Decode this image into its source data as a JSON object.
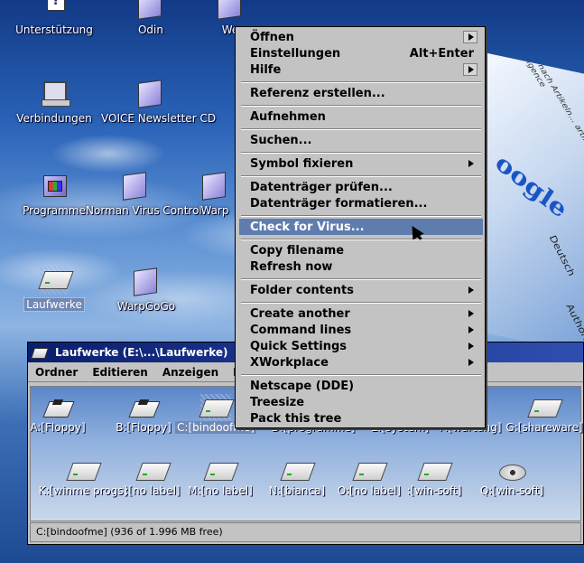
{
  "desktop": {
    "icons": [
      {
        "label": "Unterstützung",
        "icon": "help-book-icon"
      },
      {
        "label": "Odin",
        "icon": "folder-icon"
      },
      {
        "label": "We",
        "icon": "folder-icon"
      },
      {
        "label": "Verbindungen",
        "icon": "network-computer-icon"
      },
      {
        "label": "VOICE Newsletter CD",
        "icon": "folder-icon"
      },
      {
        "label": "Programme",
        "icon": "programs-folder-icon"
      },
      {
        "label": "Norman Virus Control",
        "icon": "folder-icon"
      },
      {
        "label": "Warp",
        "icon": "folder-icon"
      },
      {
        "label": "Laufwerke",
        "icon": "drives-icon"
      },
      {
        "label": "WarpGoGo",
        "icon": "folder-icon"
      }
    ],
    "banner_logo_text": "oogle",
    "banner_side_text": "Deutsch",
    "banner_top_text": "Suche nach Artikeln... artificial intelligence",
    "banner_author_text": "Author:"
  },
  "window": {
    "title": "Laufwerke (E:\\...\\Laufwerke)",
    "menu": [
      "Ordner",
      "Editieren",
      "Anzeigen",
      "H"
    ],
    "drives": [
      {
        "label": "A:[Floppy]",
        "icon": "floppy-drive-icon"
      },
      {
        "label": "B:[Floppy]",
        "icon": "floppy-drive-icon"
      },
      {
        "label": "C:[bindoofme]",
        "icon": "hard-drive-icon"
      },
      {
        "label": "D:[programme]",
        "icon": "hard-drive-icon"
      },
      {
        "label": "E:[system]",
        "icon": "hard-drive-icon"
      },
      {
        "label": "F:[wartung]",
        "icon": "hard-drive-icon"
      },
      {
        "label": "G:[shareware]",
        "icon": "hard-drive-icon"
      },
      {
        "label": "K:[winme progs]",
        "icon": "hard-drive-icon"
      },
      {
        "label": ":[no label]",
        "icon": "hard-drive-icon"
      },
      {
        "label": "M:[no label]",
        "icon": "hard-drive-icon"
      },
      {
        "label": "N:[bianca]",
        "icon": "hard-drive-icon"
      },
      {
        "label": "O:[no label]",
        "icon": "hard-drive-icon"
      },
      {
        "label": ":[win-soft]",
        "icon": "hard-drive-icon"
      },
      {
        "label": "Q:[win-soft]",
        "icon": "cd-rom-icon"
      }
    ],
    "status": "C:[bindoofme] (936 of 1.996 MB free)"
  },
  "context_menu": {
    "items": [
      {
        "label": "Öffnen",
        "submenu": true
      },
      {
        "label": "Einstellungen",
        "accel": "Alt+Enter"
      },
      {
        "label": "Hilfe",
        "submenu": true
      },
      {
        "label": "Referenz erstellen..."
      },
      {
        "label": "Aufnehmen"
      },
      {
        "label": "Suchen..."
      },
      {
        "label": "Symbol fixieren",
        "submenu": true
      },
      {
        "label": "Datenträger prüfen..."
      },
      {
        "label": "Datenträger formatieren..."
      },
      {
        "label": "Check for Virus...",
        "highlighted": true
      },
      {
        "label": "Copy filename"
      },
      {
        "label": "Refresh now"
      },
      {
        "label": "Folder contents",
        "submenu": true
      },
      {
        "label": "Create another",
        "submenu": true
      },
      {
        "label": "Command lines",
        "submenu": true
      },
      {
        "label": "Quick Settings",
        "submenu": true
      },
      {
        "label": "XWorkplace",
        "submenu": true
      },
      {
        "label": "Netscape (DDE)"
      },
      {
        "label": "Treesize"
      },
      {
        "label": "Pack this tree"
      }
    ]
  },
  "colors": {
    "highlight": "#5f7cae",
    "title_bar": "#0a1e6e",
    "menu_bg": "#c3c3c3"
  }
}
